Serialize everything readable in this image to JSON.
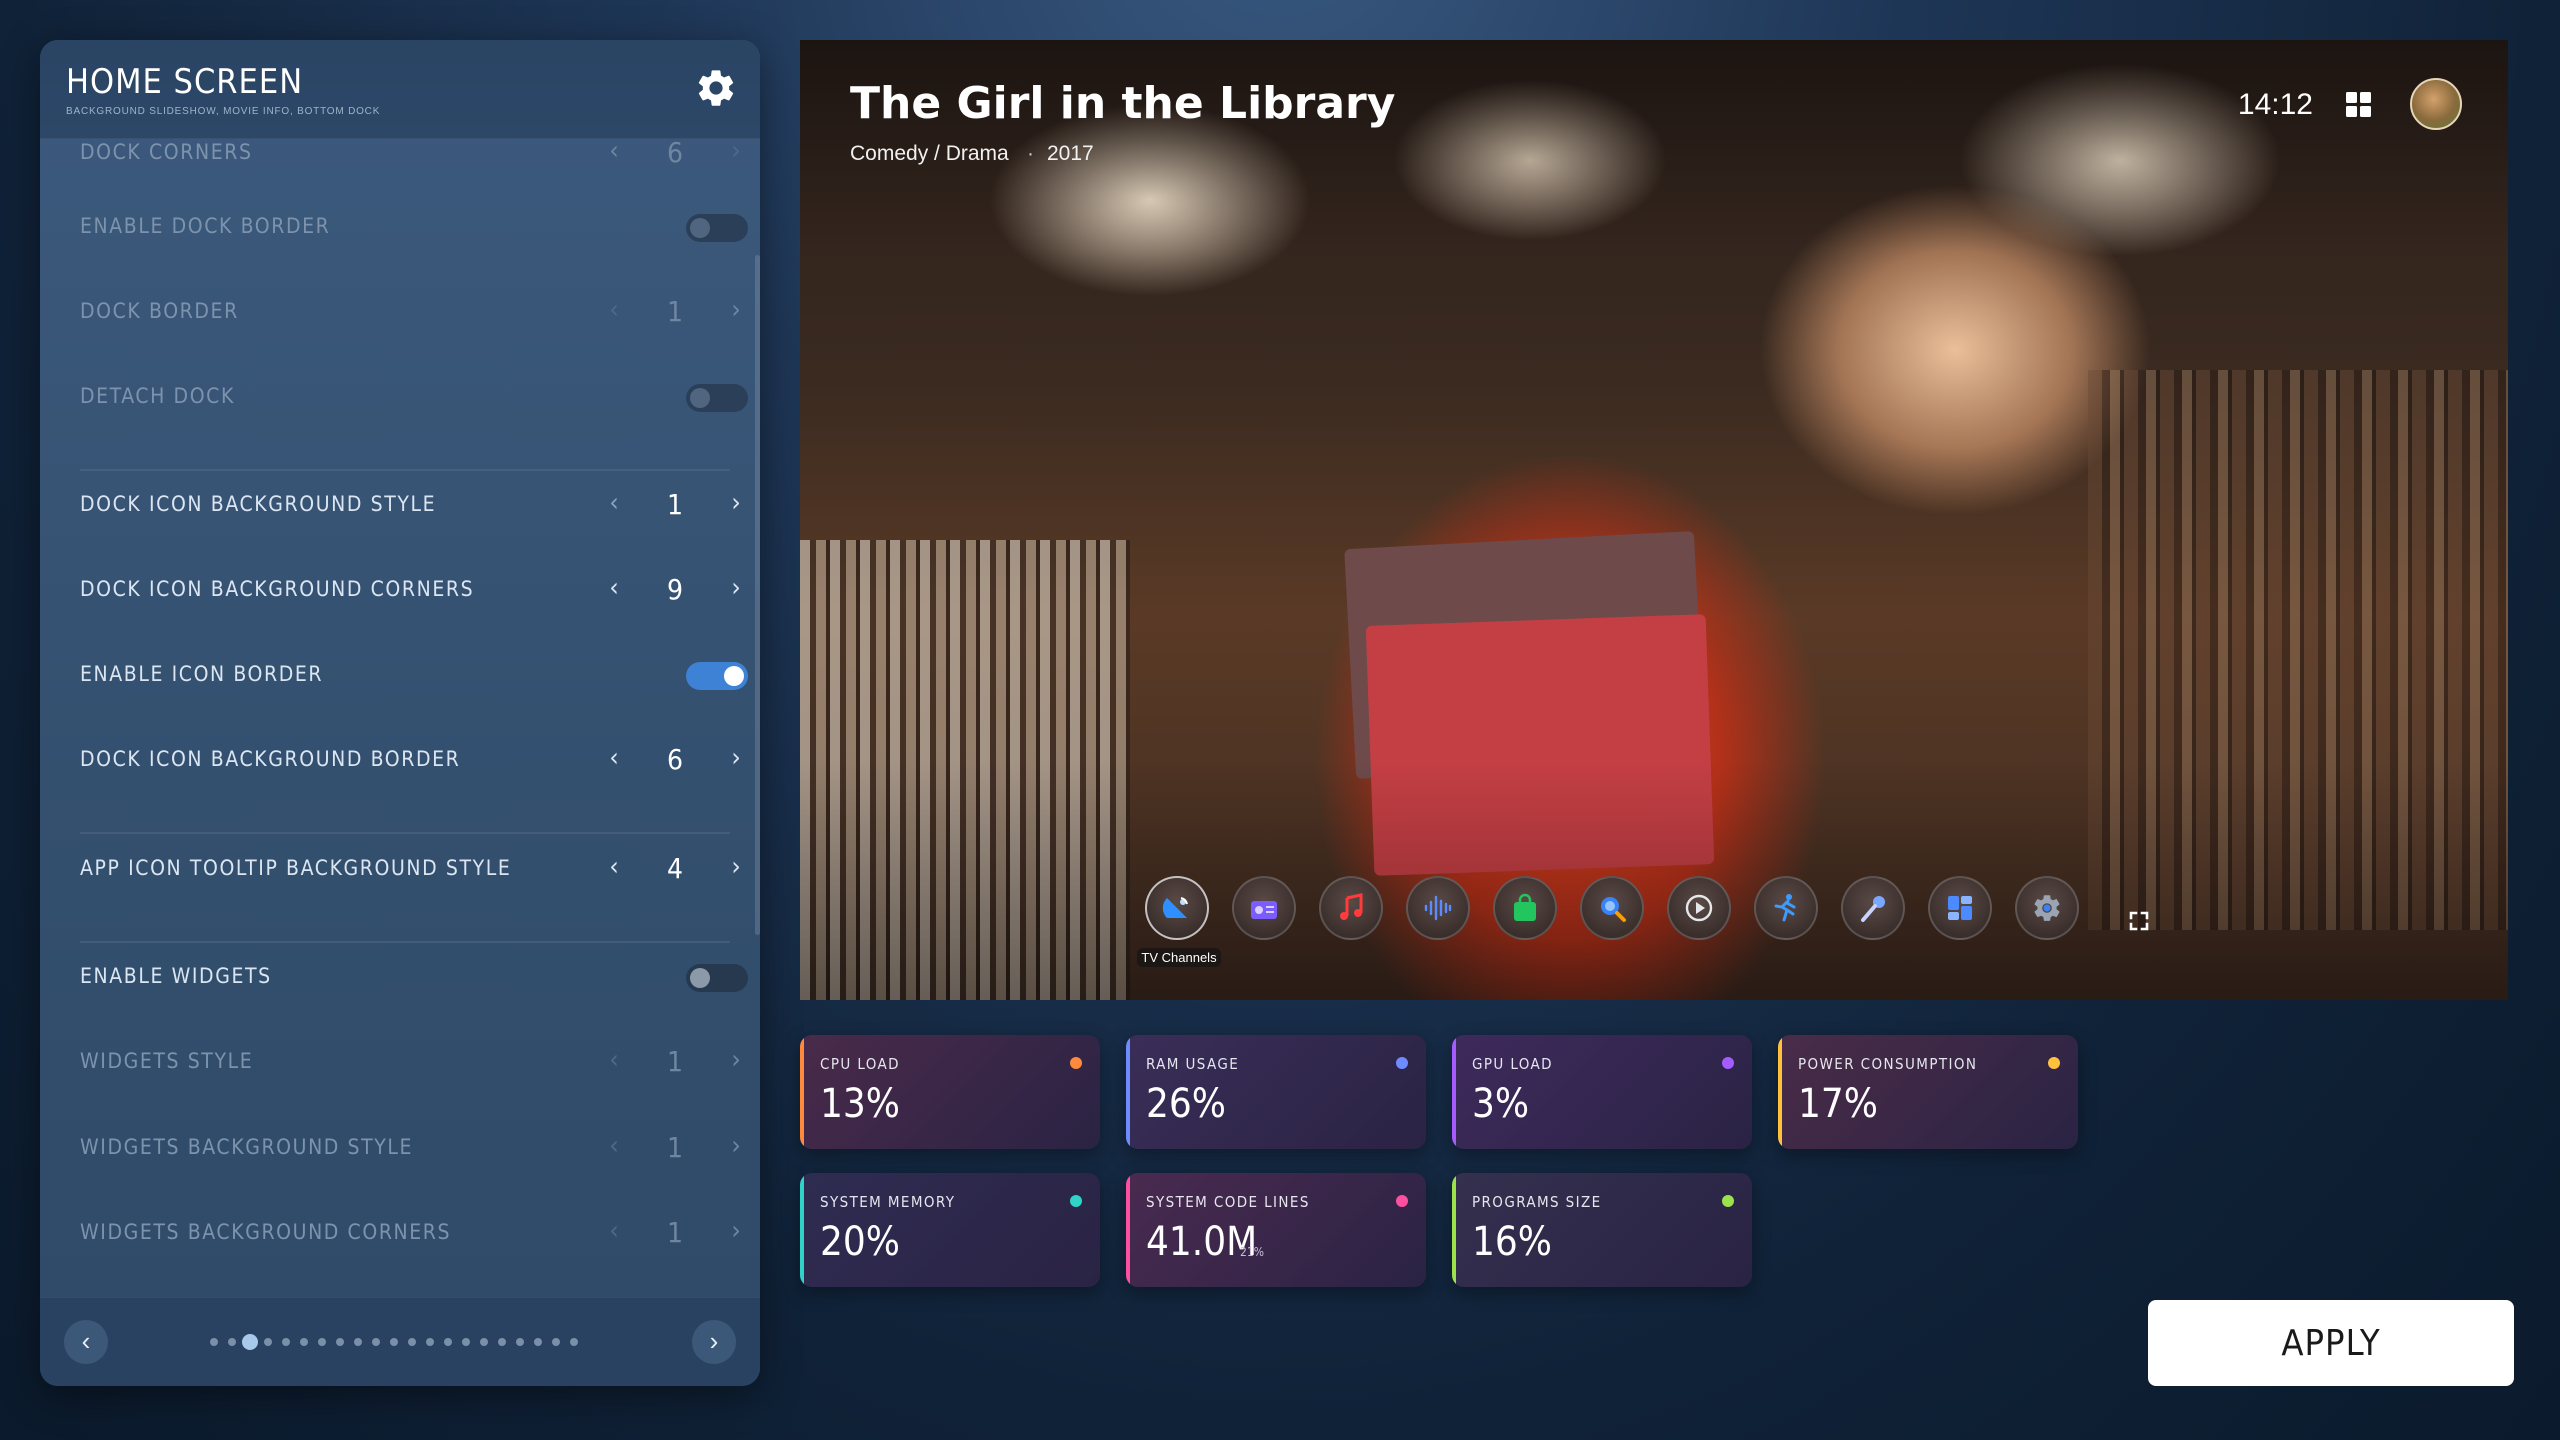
{
  "panel": {
    "title": "HOME SCREEN",
    "subtitle": "BACKGROUND SLIDESHOW, MOVIE INFO, BOTTOM DOCK",
    "rows": [
      {
        "label": "DOCK CORNERS",
        "kind": "stepper",
        "value": "6",
        "dim": true
      },
      {
        "label": "ENABLE DOCK BORDER",
        "kind": "toggle",
        "on": false,
        "dim": true
      },
      {
        "label": "DOCK BORDER",
        "kind": "stepper",
        "value": "1",
        "dim": true
      },
      {
        "label": "DETACH DOCK",
        "kind": "toggle",
        "on": false,
        "dim": true
      },
      {
        "label": "DOCK ICON BACKGROUND STYLE",
        "kind": "stepper",
        "value": "1",
        "dim": false
      },
      {
        "label": "DOCK ICON BACKGROUND CORNERS",
        "kind": "stepper",
        "value": "9",
        "dim": false
      },
      {
        "label": "ENABLE ICON BORDER",
        "kind": "toggle",
        "on": true,
        "dim": false
      },
      {
        "label": "DOCK ICON BACKGROUND BORDER",
        "kind": "stepper",
        "value": "6",
        "dim": false
      },
      {
        "label": "APP ICON TOOLTIP BACKGROUND STYLE",
        "kind": "stepper",
        "value": "4",
        "dim": false
      },
      {
        "label": "ENABLE WIDGETS",
        "kind": "toggle",
        "on": false,
        "dim": false
      },
      {
        "label": "WIDGETS STYLE",
        "kind": "stepper",
        "value": "1",
        "dim": true
      },
      {
        "label": "WIDGETS BACKGROUND STYLE",
        "kind": "stepper",
        "value": "1",
        "dim": true
      },
      {
        "label": "WIDGETS BACKGROUND CORNERS",
        "kind": "stepper",
        "value": "1",
        "dim": true
      }
    ],
    "pagination": {
      "pages": 21,
      "current": 3
    }
  },
  "hero": {
    "title": "The Girl in the Library",
    "genre": "Comedy / Drama",
    "separator": "·",
    "year": "2017",
    "clock": "14:12",
    "dock": [
      {
        "icon": "satellite-dish-icon",
        "tooltip": "TV Channels",
        "color": "#2f8fff"
      },
      {
        "icon": "radio-icon",
        "color": "#7b5cff"
      },
      {
        "icon": "music-note-icon",
        "color": "#ff3b3b"
      },
      {
        "icon": "audio-wave-icon",
        "color": "#5b8cff"
      },
      {
        "icon": "shopping-bag-icon",
        "color": "#22c55e"
      },
      {
        "icon": "search-icon",
        "color": "#3b82f6"
      },
      {
        "icon": "play-icon",
        "color": "#e5e7eb"
      },
      {
        "icon": "runner-icon",
        "color": "#3b9bff"
      },
      {
        "icon": "microphone-icon",
        "color": "#7aa8ff"
      },
      {
        "icon": "dashboard-icon",
        "color": "#4b8bff"
      },
      {
        "icon": "settings-gear-icon",
        "color": "#9aa4b2"
      }
    ]
  },
  "stats": [
    {
      "label": "CPU LOAD",
      "value": "13%",
      "accent": "#ff8a3d",
      "bg": "#4a2a4a"
    },
    {
      "label": "RAM USAGE",
      "value": "26%",
      "accent": "#6f8cff",
      "bg": "#3a2e58"
    },
    {
      "label": "GPU LOAD",
      "value": "3%",
      "accent": "#a45cff",
      "bg": "#3e2a5c"
    },
    {
      "label": "POWER CONSUMPTION",
      "value": "17%",
      "accent": "#ffc23d",
      "bg": "#4a2c48"
    },
    {
      "label": "SYSTEM MEMORY",
      "value": "20%",
      "accent": "#2fd3c8",
      "bg": "#2f2c52"
    },
    {
      "label": "SYSTEM CODE LINES",
      "value": "41.0M",
      "sub": "21%",
      "accent": "#ff4fa0",
      "bg": "#4a2a50"
    },
    {
      "label": "PROGRAMS SIZE",
      "value": "16%",
      "accent": "#9be34a",
      "bg": "#34304e"
    }
  ],
  "apply_label": "APPLY"
}
